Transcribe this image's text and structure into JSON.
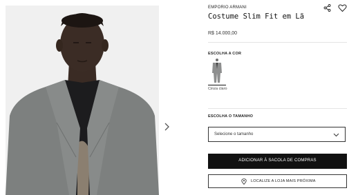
{
  "product": {
    "brand": "EMPORIO ARMANI",
    "title": "Costume Slim Fit em Lã",
    "price": "R$ 14.000,00"
  },
  "actions": {
    "share_icon": "share-icon",
    "wishlist_icon": "heart-icon"
  },
  "gallery": {
    "next_icon": "chevron-right-icon"
  },
  "color_section": {
    "label": "ESCOLHA A COR",
    "selected_color": "Cinza claro",
    "swatch_color": "#8e8f8f"
  },
  "size_section": {
    "label": "ESCOLHA O TAMANHO",
    "placeholder": "Selecione o tamanho"
  },
  "buttons": {
    "add_to_bag": "ADICIONAR À SACOLA DE COMPRAS",
    "locate_store": "LOCALIZE A LOJA MAIS PRÓXIMA"
  }
}
